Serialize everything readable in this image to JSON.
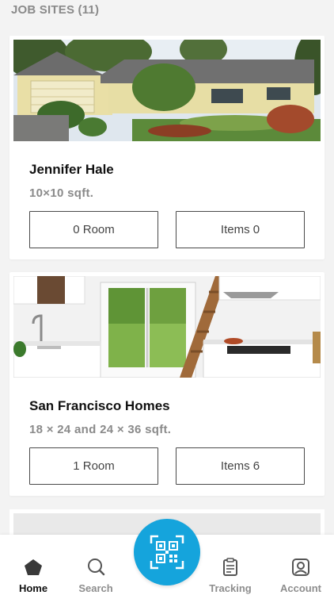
{
  "section": {
    "title": "JOB SITES (11)"
  },
  "job_sites": [
    {
      "name": "Jennifer Hale",
      "size": "10×10 sqft.",
      "rooms_label": "0 Room",
      "items_label": "Items 0",
      "image": "house-exterior"
    },
    {
      "name": "San Francisco Homes",
      "size": "18 × 24 and 24 × 36 sqft.",
      "rooms_label": "1 Room",
      "items_label": "Items 6",
      "image": "kitchen-interior"
    }
  ],
  "tabbar": {
    "home": {
      "label": "Home",
      "icon": "home-icon"
    },
    "search": {
      "label": "Search",
      "icon": "search-icon"
    },
    "scan": {
      "icon": "qr-scan-icon",
      "color": "#15a4dc"
    },
    "tracking": {
      "label": "Tracking",
      "icon": "clipboard-icon"
    },
    "account": {
      "label": "Account",
      "icon": "account-icon"
    }
  }
}
